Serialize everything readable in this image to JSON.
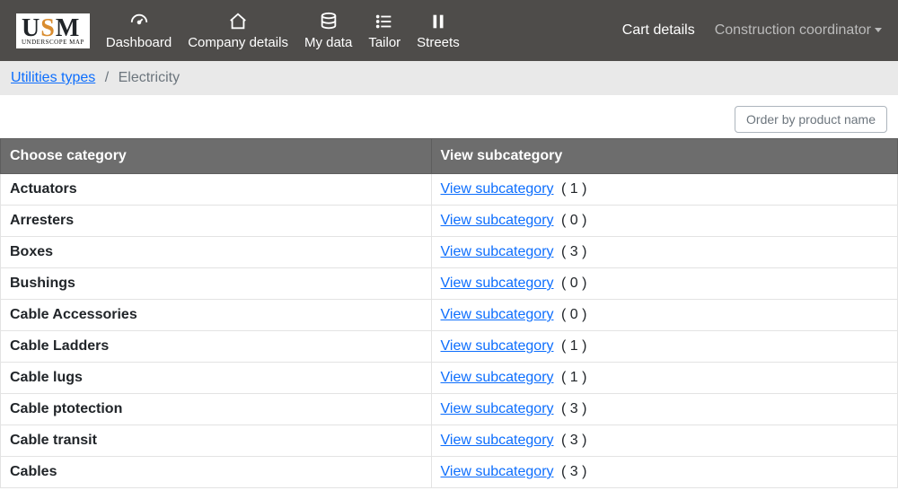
{
  "logo": {
    "main": "USM",
    "sub": "UNDERSCOPE MAP"
  },
  "nav": {
    "items": [
      {
        "label": "Dashboard",
        "icon": "gauge"
      },
      {
        "label": "Company details",
        "icon": "home"
      },
      {
        "label": "My data",
        "icon": "db"
      },
      {
        "label": "Tailor",
        "icon": "list"
      },
      {
        "label": "Streets",
        "icon": "bars"
      }
    ],
    "right": {
      "cart": "Cart details",
      "role": "Construction coordinator"
    }
  },
  "breadcrumb": {
    "parent": "Utilities types",
    "current": "Electricity"
  },
  "toolbar": {
    "order_btn": "Order by product name"
  },
  "table": {
    "headers": {
      "category": "Choose category",
      "subcat": "View subcategory"
    },
    "link_label": "View subcategory",
    "rows": [
      {
        "name": "Actuators",
        "count": 1
      },
      {
        "name": "Arresters",
        "count": 0
      },
      {
        "name": "Boxes",
        "count": 3
      },
      {
        "name": "Bushings",
        "count": 0
      },
      {
        "name": "Cable Accessories",
        "count": 0
      },
      {
        "name": "Cable Ladders",
        "count": 1
      },
      {
        "name": "Cable lugs",
        "count": 1
      },
      {
        "name": "Cable ptotection",
        "count": 3
      },
      {
        "name": "Cable transit",
        "count": 3
      },
      {
        "name": "Cables",
        "count": 3
      }
    ]
  }
}
